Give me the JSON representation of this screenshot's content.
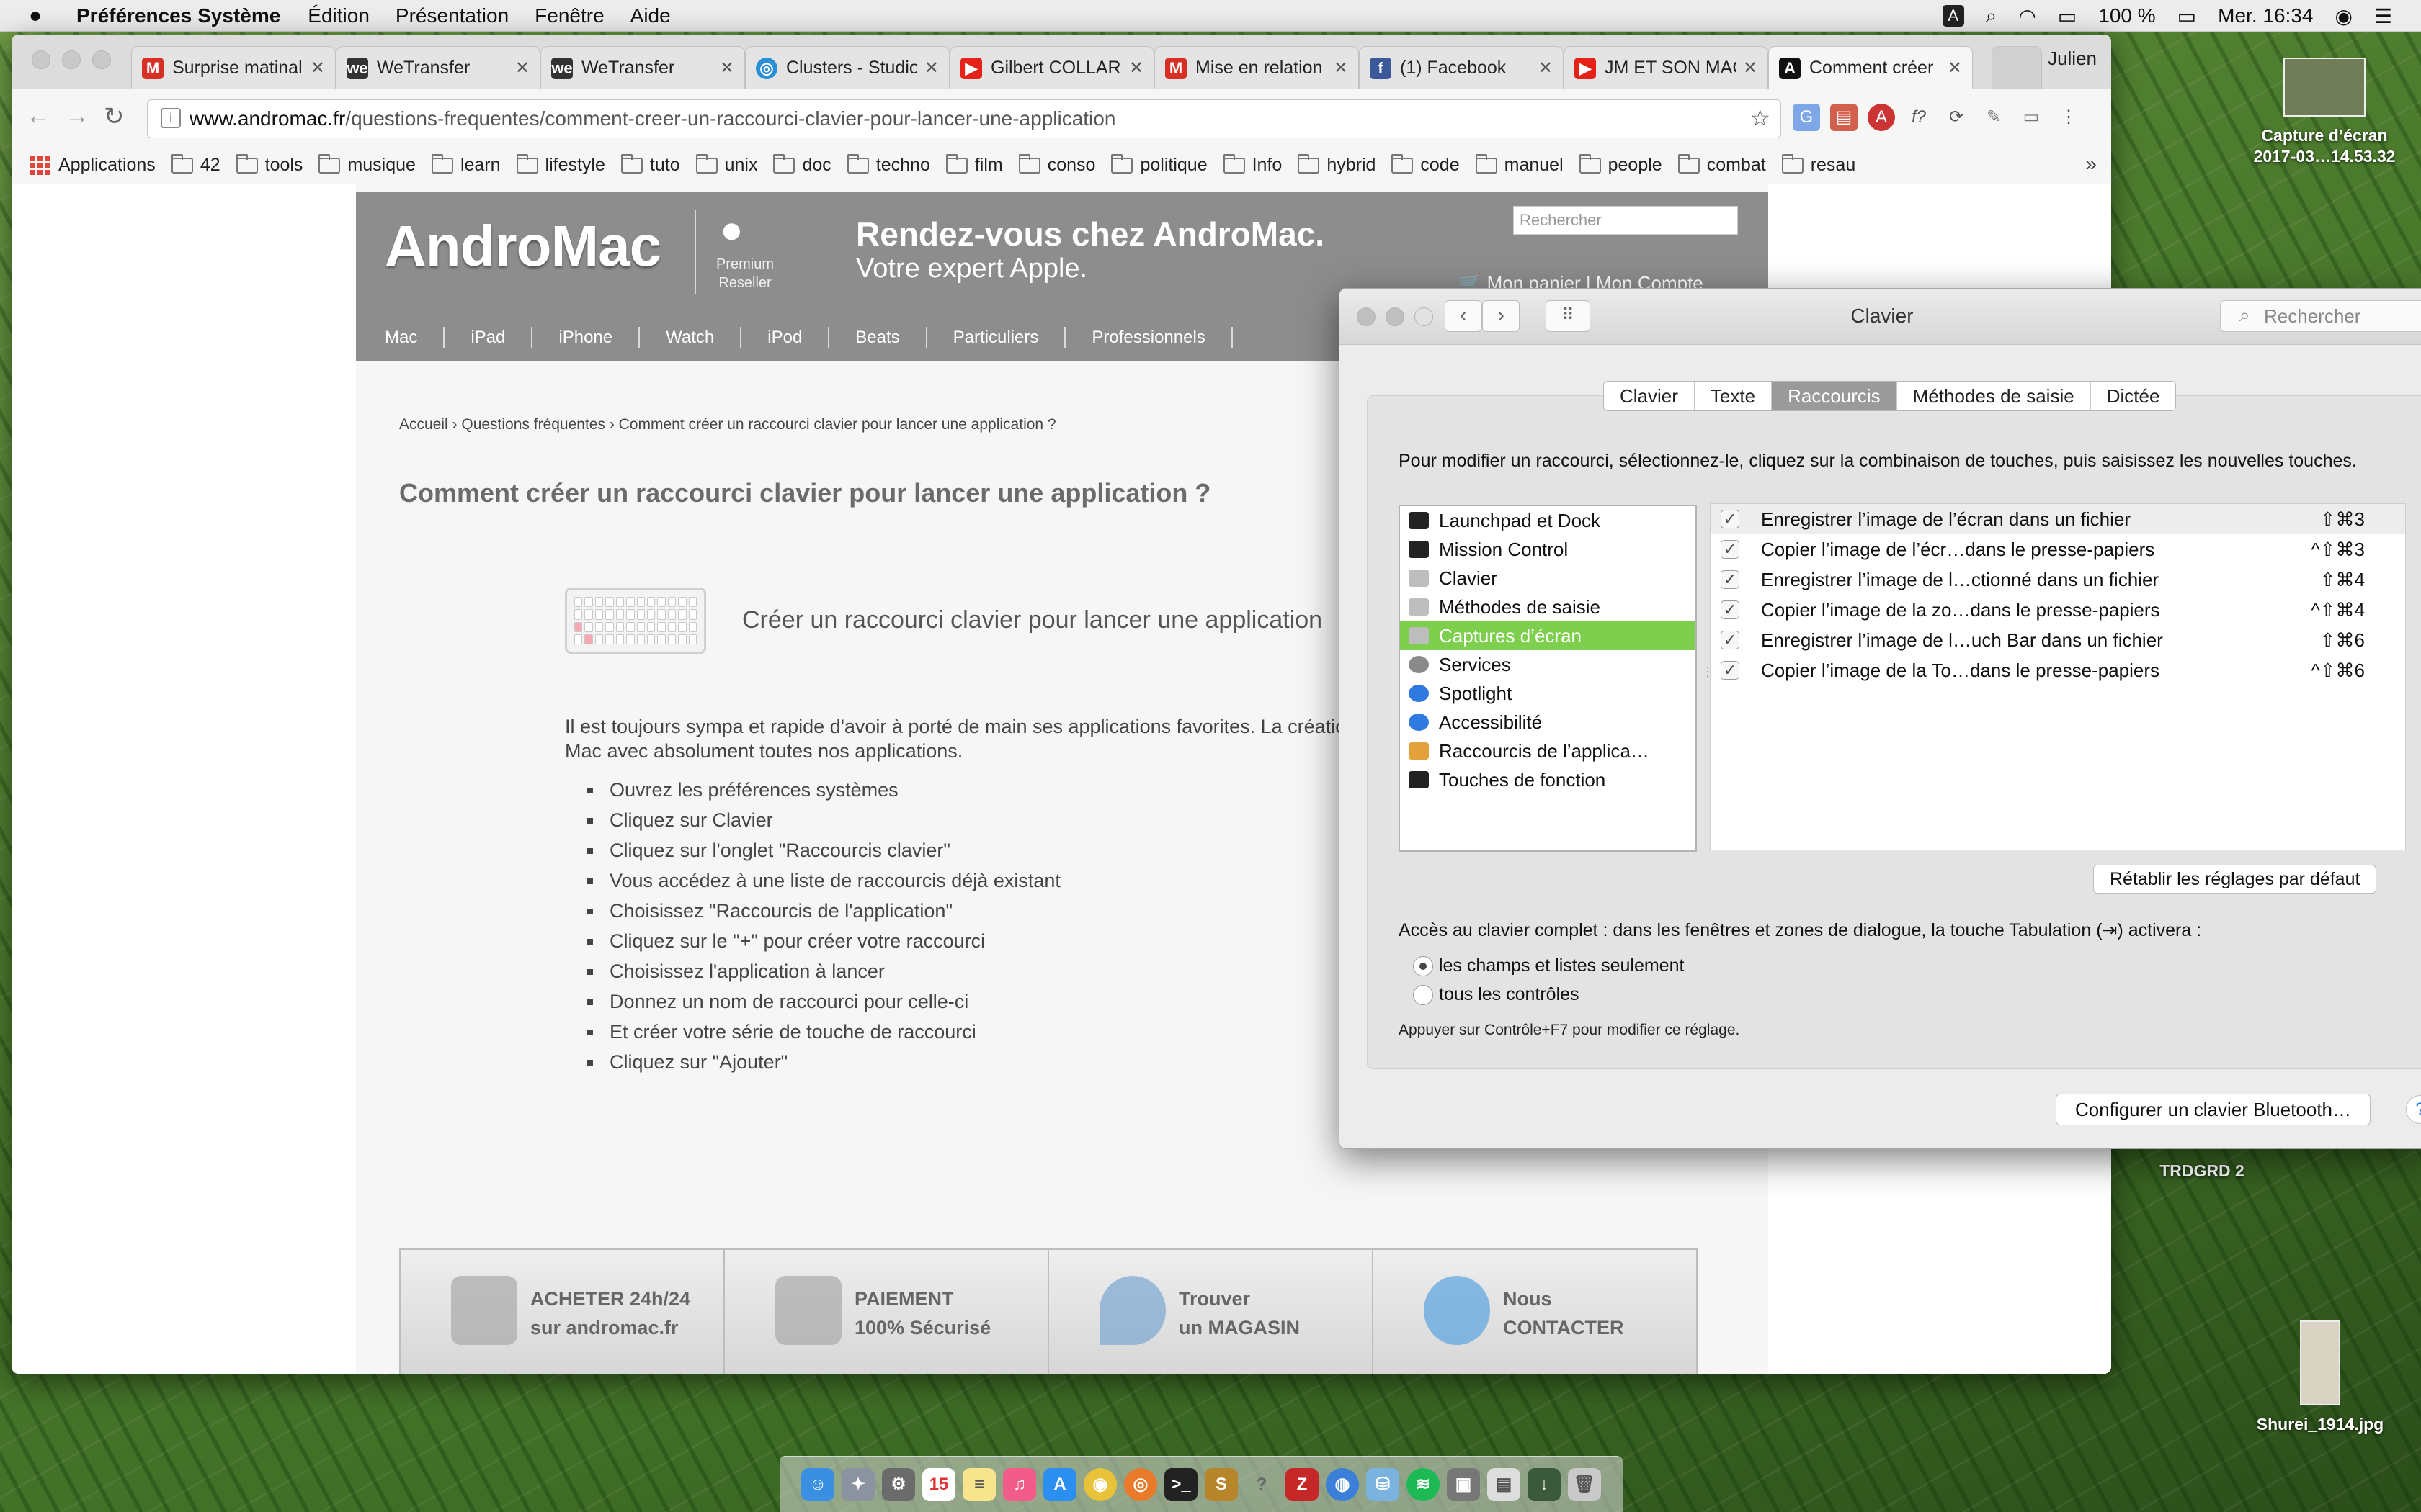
{
  "menubar": {
    "app": "Préférences Système",
    "items": [
      "Édition",
      "Présentation",
      "Fenêtre",
      "Aide"
    ],
    "battery": "100 %",
    "clock": "Mer. 16:34",
    "input_source": "A"
  },
  "browser": {
    "tabs": [
      {
        "title": "Surprise matinale",
        "icon": "gmail-icon",
        "color": "#d93025"
      },
      {
        "title": "WeTransfer",
        "icon": "wetransfer-icon",
        "color": "#333333"
      },
      {
        "title": "WeTransfer",
        "icon": "wetransfer-icon",
        "color": "#333333"
      },
      {
        "title": "Clusters - Studio",
        "icon": "clusters-icon",
        "color": "#2b8fd8"
      },
      {
        "title": "Gilbert COLLARD",
        "icon": "youtube-icon",
        "color": "#e62117"
      },
      {
        "title": "Mise en relation",
        "icon": "gmail-icon",
        "color": "#d93025"
      },
      {
        "title": "(1) Facebook",
        "icon": "facebook-icon",
        "color": "#3b5998"
      },
      {
        "title": "JM ET SON MAC",
        "icon": "youtube-icon",
        "color": "#e62117"
      },
      {
        "title": "Comment créer",
        "icon": "andromac-icon",
        "color": "#111111"
      }
    ],
    "profile": "Julien",
    "url_domain": "www.andromac.fr",
    "url_path": "/questions-frequentes/comment-creer-un-raccourci-clavier-pour-lancer-une-application",
    "bookmarks": [
      "Applications",
      "42",
      "tools",
      "musique",
      "learn",
      "lifestyle",
      "tuto",
      "unix",
      "doc",
      "techno",
      "film",
      "conso",
      "politique",
      "Info",
      "hybrid",
      "code",
      "manuel",
      "people",
      "combat",
      "resau"
    ],
    "more": "»"
  },
  "site": {
    "logo": "AndroMac",
    "premium": "Premium Reseller",
    "slogan1": "Rendez-vous chez AndroMac.",
    "slogan2": "Votre expert Apple.",
    "search_placeholder": "Rechercher",
    "cart": "Mon panier",
    "cart_sep": "|",
    "account": "Mon Compte",
    "nav": [
      "Mac",
      "iPad",
      "iPhone",
      "Watch",
      "iPod",
      "Beats",
      "Particuliers",
      "Professionnels"
    ],
    "breadcrumb": "Accueil › Questions fréquentes › Comment créer un raccourci clavier pour lancer une application ?",
    "title": "Comment créer un raccourci clavier pour lancer une application ?",
    "card_title": "Créer un raccourci clavier pour lancer une application",
    "intro": "Il est toujours sympa et rapide d'avoir à porté de main ses applications favorites. La création d'un raccourci clavier est possible sous Mac avec absolument toutes nos applications.",
    "steps": [
      "Ouvrez les préférences systèmes",
      "Cliquez sur Clavier",
      "Cliquez sur l'onglet \"Raccourcis clavier\"",
      "Vous accédez à une liste de raccourcis déjà existant",
      "Choisissez \"Raccourcis de l'application\"",
      "Cliquez sur le \"+\" pour créer votre raccourci",
      "Choisissez l'application à lancer",
      "Donnez un nom de raccourci pour celle-ci",
      "Et créer votre série de touche de raccourci",
      "Cliquez sur \"Ajouter\""
    ],
    "footer": [
      {
        "l1": "ACHETER 24h/24",
        "l2": "sur andromac.fr"
      },
      {
        "l1": "PAIEMENT",
        "l2": "100% Sécurisé"
      },
      {
        "l1": "Trouver",
        "l2": "un MAGASIN"
      },
      {
        "l1": "Nous",
        "l2": "CONTACTER"
      }
    ]
  },
  "prefs": {
    "title": "Clavier",
    "search_placeholder": "Rechercher",
    "tabs": [
      "Clavier",
      "Texte",
      "Raccourcis",
      "Méthodes de saisie",
      "Dictée"
    ],
    "active_tab": "Raccourcis",
    "instructions": "Pour modifier un raccourci, sélectionnez-le, cliquez sur la combinaison de touches, puis saisissez les nouvelles touches.",
    "categories": [
      "Launchpad et Dock",
      "Mission Control",
      "Clavier",
      "Méthodes de saisie",
      "Captures d’écran",
      "Services",
      "Spotlight",
      "Accessibilité",
      "Raccourcis de l’applica…",
      "Touches de fonction"
    ],
    "selected_category": "Captures d’écran",
    "shortcuts": [
      {
        "checked": "✓",
        "label": "Enregistrer l’image de l’écran dans un fichier",
        "keys": "⇧⌘3"
      },
      {
        "checked": "✓",
        "label": "Copier l’image de l’écr…dans le presse-papiers",
        "keys": "^⇧⌘3"
      },
      {
        "checked": "✓",
        "label": "Enregistrer l’image de l…ctionné dans un fichier",
        "keys": "⇧⌘4"
      },
      {
        "checked": "✓",
        "label": "Copier l’image de la zo…dans le presse-papiers",
        "keys": "^⇧⌘4"
      },
      {
        "checked": "✓",
        "label": "Enregistrer l’image de l…uch Bar dans un fichier",
        "keys": "⇧⌘6"
      },
      {
        "checked": "✓",
        "label": "Copier l’image de la To…dans le presse-papiers",
        "keys": "^⇧⌘6"
      }
    ],
    "reset": "Rétablir les réglages par défaut",
    "access": "Accès au clavier complet : dans les fenêtres et zones de dialogue, la touche Tabulation (⇥) activera :",
    "radio1": "les champs et listes seulement",
    "radio2": "tous les contrôles",
    "hint": "Appuyer sur Contrôle+F7 pour modifier ce réglage.",
    "bluetooth": "Configurer un clavier Bluetooth…",
    "help": "?"
  },
  "desktop": {
    "capture": "Capture d’écran 2017-03…14.53.32",
    "folder": "TRDGRD 2",
    "image": "Shurei_1914.jpg"
  },
  "dock": {
    "calendar_day": "15"
  }
}
